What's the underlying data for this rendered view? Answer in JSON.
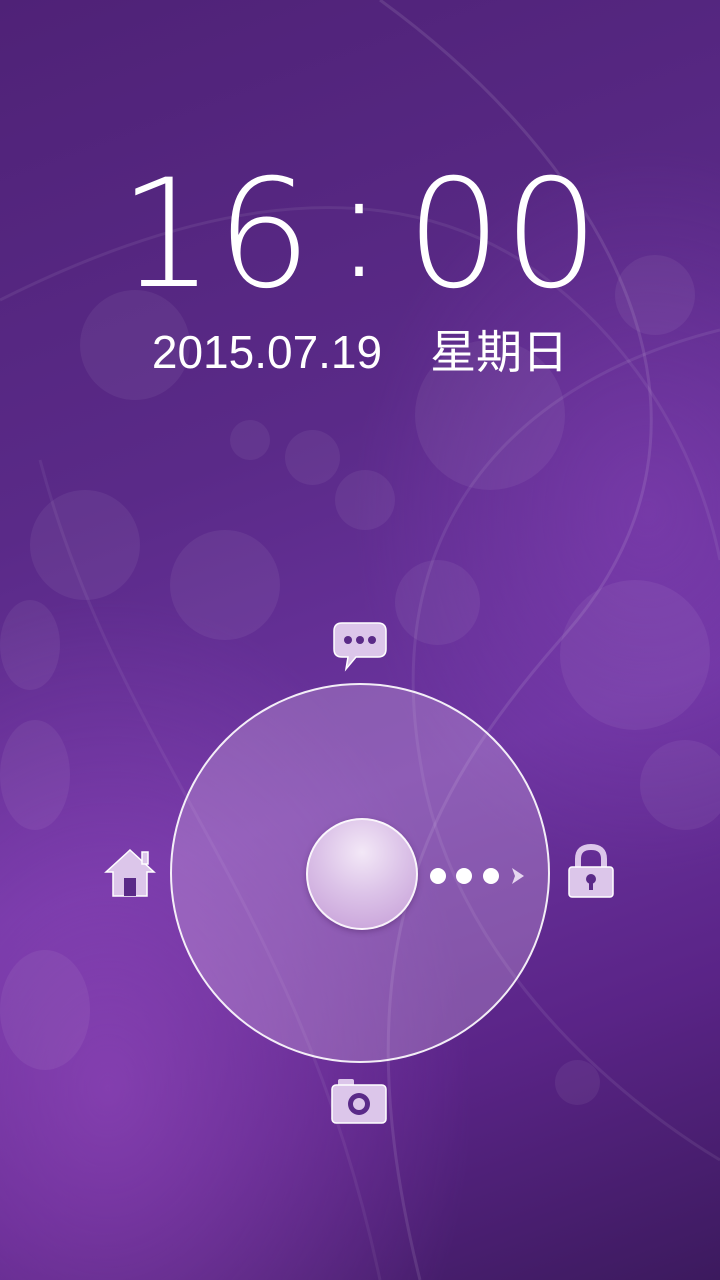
{
  "status": {
    "time_hours": "16",
    "time_separator": ":",
    "time_minutes": "00",
    "date": "2015.07.19",
    "weekday": "星期日"
  },
  "unlock_targets": [
    "message-icon",
    "home-icon",
    "lock-icon",
    "camera-icon"
  ],
  "colors": {
    "background": "#5a2a88",
    "accent": "#d8c0e6",
    "text": "#ffffff"
  }
}
